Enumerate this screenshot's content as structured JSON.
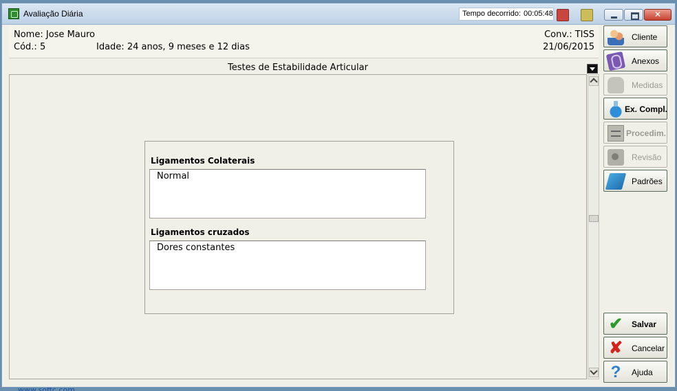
{
  "window": {
    "title": "Avaliação Diária"
  },
  "timer": {
    "label": "Tempo decorrido:",
    "value": "00:05:48"
  },
  "patient": {
    "name_label": "Nome:",
    "name": "Jose Mauro",
    "cod_label": "Cód.:",
    "cod": "5",
    "age_label": "Idade:",
    "age": "24 anos, 9 meses e 12 dias",
    "conv_label": "Conv.:",
    "conv": "TISS",
    "date": "21/06/2015"
  },
  "section": {
    "title": "Testes de Estabilidade Articular"
  },
  "fields": [
    {
      "label": "Ligamentos Colaterais",
      "value": "Normal"
    },
    {
      "label": "Ligamentos cruzados",
      "value": "Dores constantes"
    }
  ],
  "sidebar": {
    "buttons": [
      {
        "label": "Cliente",
        "enabled": true,
        "icon": "people-icon"
      },
      {
        "label": "Anexos",
        "enabled": true,
        "icon": "paperclip-icon"
      },
      {
        "label": "Medidas",
        "enabled": false,
        "icon": "measure-icon"
      },
      {
        "label": "Ex. Compl.",
        "enabled": true,
        "icon": "flask-icon"
      },
      {
        "label": "Procedim.",
        "enabled": false,
        "icon": "cabinet-icon"
      },
      {
        "label": "Revisão",
        "enabled": false,
        "icon": "camera-icon"
      },
      {
        "label": "Padrões",
        "enabled": true,
        "icon": "book-icon"
      }
    ],
    "actions": [
      {
        "label": "Salvar",
        "icon": "check-icon"
      },
      {
        "label": "Cancelar",
        "icon": "x-icon"
      },
      {
        "label": "Ajuda",
        "icon": "help-icon"
      }
    ]
  },
  "footer": {
    "url": "www.softc.com"
  },
  "colors": {
    "accent_ok": "#2e9a2e",
    "accent_cancel": "#d4231c",
    "accent_help": "#2e7fd0"
  }
}
